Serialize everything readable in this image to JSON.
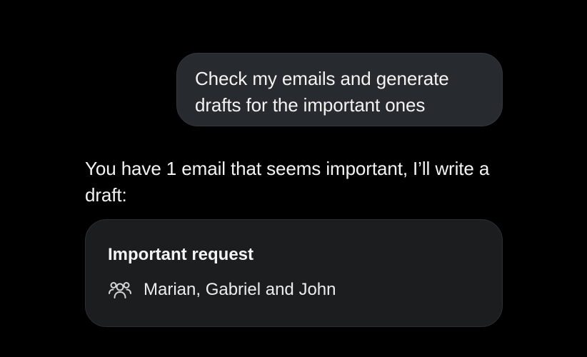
{
  "conversation": {
    "user_message": {
      "line1": "Check my emails and generate",
      "line2": "drafts for the important ones"
    },
    "assistant_message": {
      "line1": "You have 1 email that seems important, I’ll write a",
      "line2": "draft:"
    },
    "email_card": {
      "subject": "Important request",
      "icon": "people-icon",
      "recipients": "Marian, Gabriel and John"
    }
  },
  "colors": {
    "background": "#000000",
    "user_bubble": "#272a2e",
    "card": "#1c1d1f",
    "text": "#f3f3f3"
  }
}
